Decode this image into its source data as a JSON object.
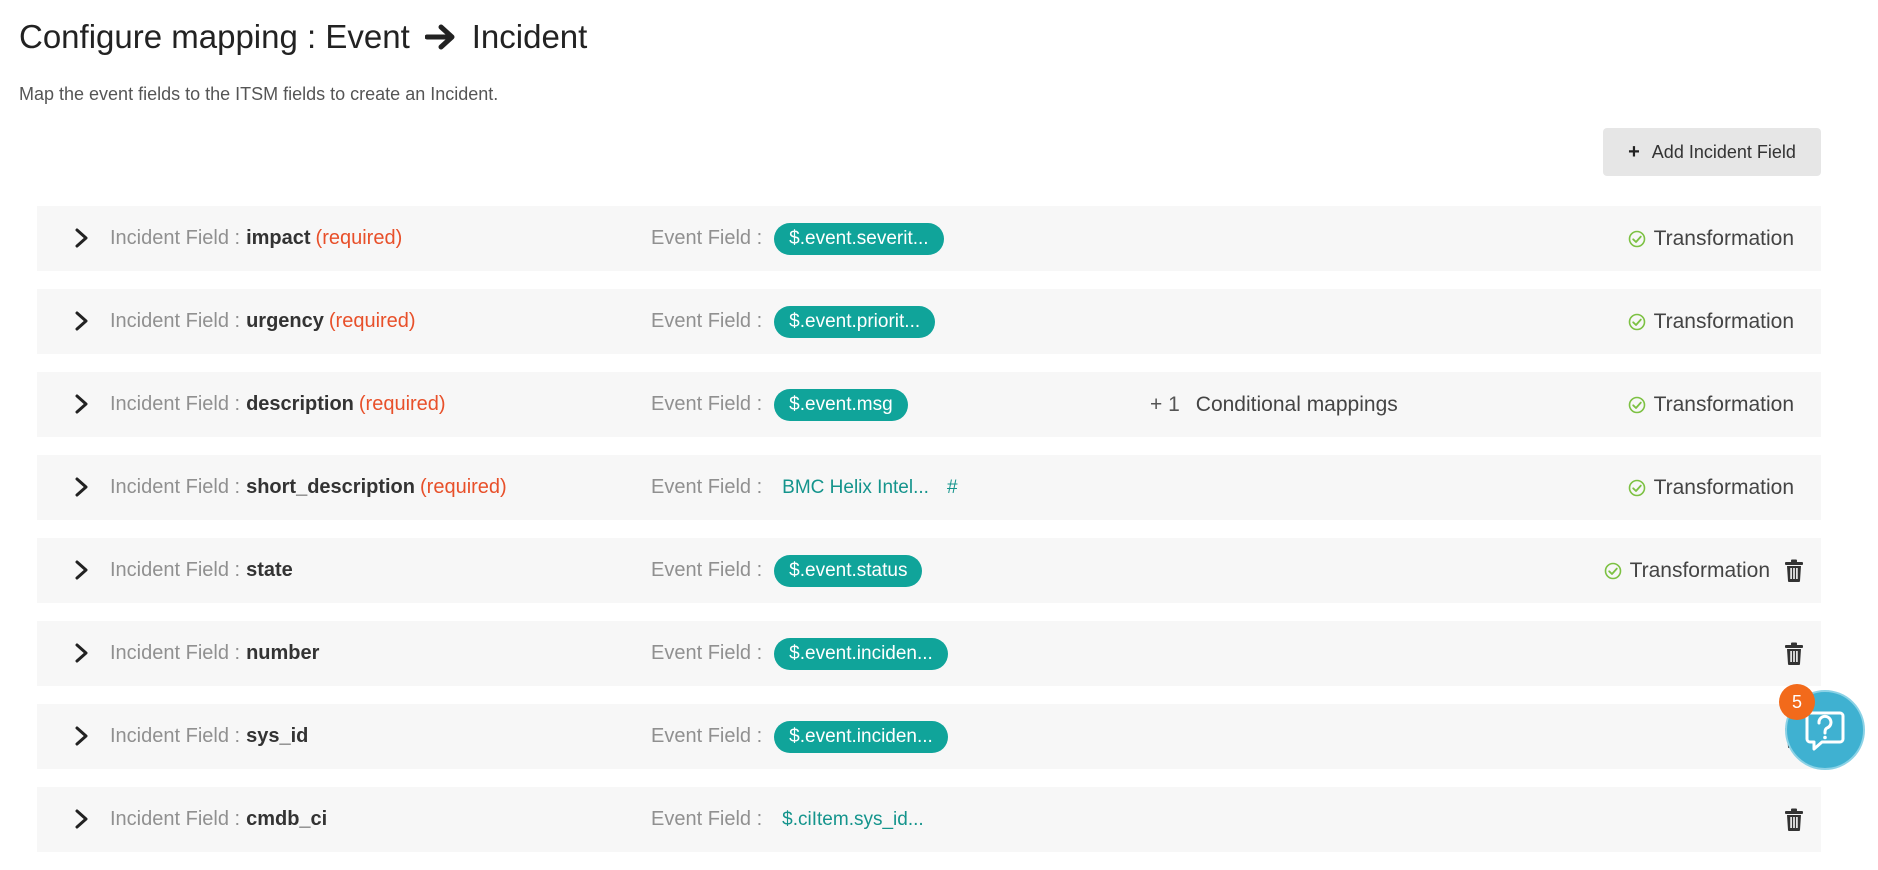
{
  "header": {
    "title_prefix": "Configure mapping : Event",
    "title_suffix": "Incident",
    "subtitle": "Map the event fields to the ITSM fields to create an Incident.",
    "add_button_label": "Add Incident Field"
  },
  "labels": {
    "incident_field": "Incident Field :",
    "event_field": "Event Field :",
    "required": "(required)",
    "transformation": "Transformation",
    "conditional_mappings": "Conditional mappings"
  },
  "rows": [
    {
      "field": "impact",
      "required": true,
      "event_value": "$.event.severit...",
      "value_style": "pill",
      "transformation": true,
      "deletable": false
    },
    {
      "field": "urgency",
      "required": true,
      "event_value": "$.event.priorit...",
      "value_style": "pill",
      "transformation": true,
      "deletable": false
    },
    {
      "field": "description",
      "required": true,
      "event_value": "$.event.msg",
      "value_style": "pill",
      "conditional_count": "+ 1",
      "transformation": true,
      "deletable": false
    },
    {
      "field": "short_description",
      "required": true,
      "event_value": "BMC Helix Intel...",
      "value_style": "plain",
      "hash": "#",
      "transformation": true,
      "deletable": false
    },
    {
      "field": "state",
      "required": false,
      "event_value": "$.event.status",
      "value_style": "pill",
      "transformation": true,
      "deletable": true
    },
    {
      "field": "number",
      "required": false,
      "event_value": "$.event.inciden...",
      "value_style": "pill",
      "transformation": false,
      "deletable": true
    },
    {
      "field": "sys_id",
      "required": false,
      "event_value": "$.event.inciden...",
      "value_style": "pill",
      "transformation": false,
      "deletable": true
    },
    {
      "field": "cmdb_ci",
      "required": false,
      "event_value": "$.ciItem.sys_id...",
      "value_style": "plain",
      "transformation": false,
      "deletable": true
    }
  ],
  "help": {
    "badge_count": "5"
  },
  "colors": {
    "pill": "#10a49a",
    "required": "#e8502a",
    "check": "#7cc142",
    "badge": "#f26a1b",
    "help_button": "#3fb1d1"
  },
  "icons": {
    "arrow": "arrow-right-icon",
    "expand": "chevron-right-icon",
    "check": "check-circle-icon",
    "delete": "trash-icon",
    "help": "help-chat-icon"
  }
}
